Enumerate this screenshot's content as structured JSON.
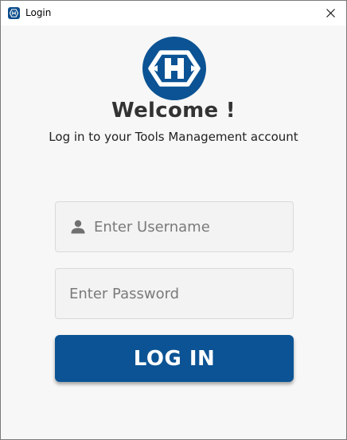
{
  "window": {
    "title": "Login",
    "icon": "app-logo-icon",
    "close_icon": "close-icon"
  },
  "header": {
    "logo": "hex-h-logo",
    "welcome": "Welcome !",
    "subtitle": "Log in to your Tools Management account"
  },
  "form": {
    "username": {
      "placeholder": "Enter Username",
      "value": "",
      "icon": "user-icon"
    },
    "password": {
      "placeholder": "Enter Password",
      "value": ""
    },
    "login_label": "LOG IN"
  },
  "colors": {
    "accent": "#0b5394",
    "background": "#f7f7f7",
    "title_text": "#333333"
  }
}
